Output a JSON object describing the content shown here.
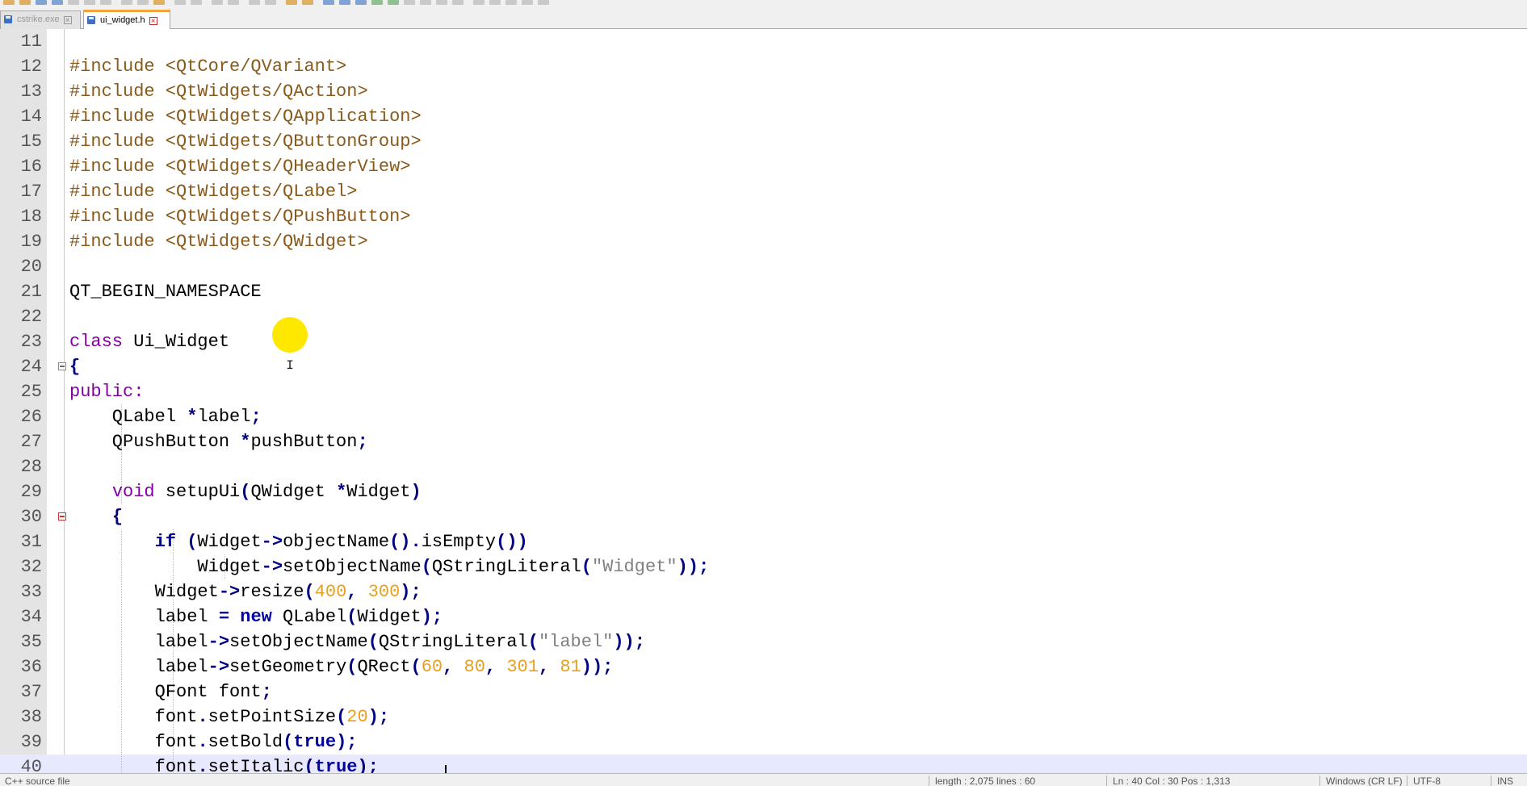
{
  "tabs": [
    {
      "label": "cstrike.exe",
      "active": false,
      "icon": "save-icon"
    },
    {
      "label": "ui_widget.h",
      "active": true,
      "icon": "save-icon"
    }
  ],
  "editor": {
    "current_line": "40",
    "lines": [
      {
        "n": "11",
        "tokens": []
      },
      {
        "n": "12",
        "tokens": [
          {
            "t": "#include <QtCore/QVariant>",
            "c": "pre"
          }
        ]
      },
      {
        "n": "13",
        "tokens": [
          {
            "t": "#include <QtWidgets/QAction>",
            "c": "pre"
          }
        ]
      },
      {
        "n": "14",
        "tokens": [
          {
            "t": "#include <QtWidgets/QApplication>",
            "c": "pre"
          }
        ]
      },
      {
        "n": "15",
        "tokens": [
          {
            "t": "#include <QtWidgets/QButtonGroup>",
            "c": "pre"
          }
        ]
      },
      {
        "n": "16",
        "tokens": [
          {
            "t": "#include <QtWidgets/QHeaderView>",
            "c": "pre"
          }
        ]
      },
      {
        "n": "17",
        "tokens": [
          {
            "t": "#include <QtWidgets/QLabel>",
            "c": "pre"
          }
        ]
      },
      {
        "n": "18",
        "tokens": [
          {
            "t": "#include <QtWidgets/QPushButton>",
            "c": "pre"
          }
        ]
      },
      {
        "n": "19",
        "tokens": [
          {
            "t": "#include <QtWidgets/QWidget>",
            "c": "pre"
          }
        ]
      },
      {
        "n": "20",
        "tokens": []
      },
      {
        "n": "21",
        "tokens": [
          {
            "t": "QT_BEGIN_NAMESPACE",
            "c": "plain"
          }
        ]
      },
      {
        "n": "22",
        "tokens": []
      },
      {
        "n": "23",
        "tokens": [
          {
            "t": "class",
            "c": "kw"
          },
          {
            "t": " Ui_Widget",
            "c": "plain"
          }
        ]
      },
      {
        "n": "24",
        "tokens": [
          {
            "t": "{",
            "c": "op"
          }
        ]
      },
      {
        "n": "25",
        "tokens": [
          {
            "t": "public:",
            "c": "kw"
          }
        ]
      },
      {
        "n": "26",
        "tokens": [
          {
            "t": "    QLabel ",
            "c": "plain"
          },
          {
            "t": "*",
            "c": "op"
          },
          {
            "t": "label",
            "c": "plain"
          },
          {
            "t": ";",
            "c": "op"
          }
        ]
      },
      {
        "n": "27",
        "tokens": [
          {
            "t": "    QPushButton ",
            "c": "plain"
          },
          {
            "t": "*",
            "c": "op"
          },
          {
            "t": "pushButton",
            "c": "plain"
          },
          {
            "t": ";",
            "c": "op"
          }
        ]
      },
      {
        "n": "28",
        "tokens": []
      },
      {
        "n": "29",
        "tokens": [
          {
            "t": "    ",
            "c": "plain"
          },
          {
            "t": "void",
            "c": "kw"
          },
          {
            "t": " setupUi",
            "c": "plain"
          },
          {
            "t": "(",
            "c": "op"
          },
          {
            "t": "QWidget ",
            "c": "plain"
          },
          {
            "t": "*",
            "c": "op"
          },
          {
            "t": "Widget",
            "c": "plain"
          },
          {
            "t": ")",
            "c": "op"
          }
        ]
      },
      {
        "n": "30",
        "tokens": [
          {
            "t": "    ",
            "c": "plain"
          },
          {
            "t": "{",
            "c": "op"
          }
        ]
      },
      {
        "n": "31",
        "tokens": [
          {
            "t": "        ",
            "c": "plain"
          },
          {
            "t": "if",
            "c": "kwb"
          },
          {
            "t": " ",
            "c": "plain"
          },
          {
            "t": "(",
            "c": "op"
          },
          {
            "t": "Widget",
            "c": "plain"
          },
          {
            "t": "->",
            "c": "op"
          },
          {
            "t": "objectName",
            "c": "plain"
          },
          {
            "t": "().",
            "c": "op"
          },
          {
            "t": "isEmpty",
            "c": "plain"
          },
          {
            "t": "())",
            "c": "op"
          }
        ]
      },
      {
        "n": "32",
        "tokens": [
          {
            "t": "            Widget",
            "c": "plain"
          },
          {
            "t": "->",
            "c": "op"
          },
          {
            "t": "setObjectName",
            "c": "plain"
          },
          {
            "t": "(",
            "c": "op"
          },
          {
            "t": "QStringLiteral",
            "c": "plain"
          },
          {
            "t": "(",
            "c": "op"
          },
          {
            "t": "\"Widget\"",
            "c": "str"
          },
          {
            "t": "));",
            "c": "op"
          }
        ]
      },
      {
        "n": "33",
        "tokens": [
          {
            "t": "        Widget",
            "c": "plain"
          },
          {
            "t": "->",
            "c": "op"
          },
          {
            "t": "resize",
            "c": "plain"
          },
          {
            "t": "(",
            "c": "op"
          },
          {
            "t": "400",
            "c": "num"
          },
          {
            "t": ", ",
            "c": "op"
          },
          {
            "t": "300",
            "c": "num"
          },
          {
            "t": ");",
            "c": "op"
          }
        ]
      },
      {
        "n": "34",
        "tokens": [
          {
            "t": "        label ",
            "c": "plain"
          },
          {
            "t": "=",
            "c": "op"
          },
          {
            "t": " ",
            "c": "plain"
          },
          {
            "t": "new",
            "c": "kwb"
          },
          {
            "t": " QLabel",
            "c": "plain"
          },
          {
            "t": "(",
            "c": "op"
          },
          {
            "t": "Widget",
            "c": "plain"
          },
          {
            "t": ");",
            "c": "op"
          }
        ]
      },
      {
        "n": "35",
        "tokens": [
          {
            "t": "        label",
            "c": "plain"
          },
          {
            "t": "->",
            "c": "op"
          },
          {
            "t": "setObjectName",
            "c": "plain"
          },
          {
            "t": "(",
            "c": "op"
          },
          {
            "t": "QStringLiteral",
            "c": "plain"
          },
          {
            "t": "(",
            "c": "op"
          },
          {
            "t": "\"label\"",
            "c": "str"
          },
          {
            "t": "));",
            "c": "op"
          }
        ]
      },
      {
        "n": "36",
        "tokens": [
          {
            "t": "        label",
            "c": "plain"
          },
          {
            "t": "->",
            "c": "op"
          },
          {
            "t": "setGeometry",
            "c": "plain"
          },
          {
            "t": "(",
            "c": "op"
          },
          {
            "t": "QRect",
            "c": "plain"
          },
          {
            "t": "(",
            "c": "op"
          },
          {
            "t": "60",
            "c": "num"
          },
          {
            "t": ", ",
            "c": "op"
          },
          {
            "t": "80",
            "c": "num"
          },
          {
            "t": ", ",
            "c": "op"
          },
          {
            "t": "301",
            "c": "num"
          },
          {
            "t": ", ",
            "c": "op"
          },
          {
            "t": "81",
            "c": "num"
          },
          {
            "t": "));",
            "c": "op"
          }
        ]
      },
      {
        "n": "37",
        "tokens": [
          {
            "t": "        QFont font",
            "c": "plain"
          },
          {
            "t": ";",
            "c": "op"
          }
        ]
      },
      {
        "n": "38",
        "tokens": [
          {
            "t": "        font",
            "c": "plain"
          },
          {
            "t": ".",
            "c": "op"
          },
          {
            "t": "setPointSize",
            "c": "plain"
          },
          {
            "t": "(",
            "c": "op"
          },
          {
            "t": "20",
            "c": "num"
          },
          {
            "t": ");",
            "c": "op"
          }
        ]
      },
      {
        "n": "39",
        "tokens": [
          {
            "t": "        font",
            "c": "plain"
          },
          {
            "t": ".",
            "c": "op"
          },
          {
            "t": "setBold",
            "c": "plain"
          },
          {
            "t": "(",
            "c": "op"
          },
          {
            "t": "true",
            "c": "kwb"
          },
          {
            "t": ");",
            "c": "op"
          }
        ]
      },
      {
        "n": "40",
        "tokens": [
          {
            "t": "        font",
            "c": "plain"
          },
          {
            "t": ".",
            "c": "op"
          },
          {
            "t": "setItalic",
            "c": "plain"
          },
          {
            "t": "(",
            "c": "op"
          },
          {
            "t": "true",
            "c": "kwb"
          },
          {
            "t": ");",
            "c": "op"
          }
        ]
      }
    ]
  },
  "cursor": {
    "glyph": "I"
  },
  "statusbar": {
    "file_type": "C++ source file",
    "length": "length : 2,075    lines : 60",
    "position": "Ln : 40    Col : 30    Pos : 1,313",
    "eol": "Windows (CR LF)",
    "encoding": "UTF-8",
    "mode": "INS"
  },
  "colors": {
    "preprocessor": "#8a5a1a",
    "keyword": "#8000a0",
    "keyword_bold": "#0000a0",
    "operator": "#000080",
    "number": "#e8a020",
    "string": "#808080",
    "current_line": "#e8e8ff",
    "cursor_highlight": "#ffe800"
  }
}
